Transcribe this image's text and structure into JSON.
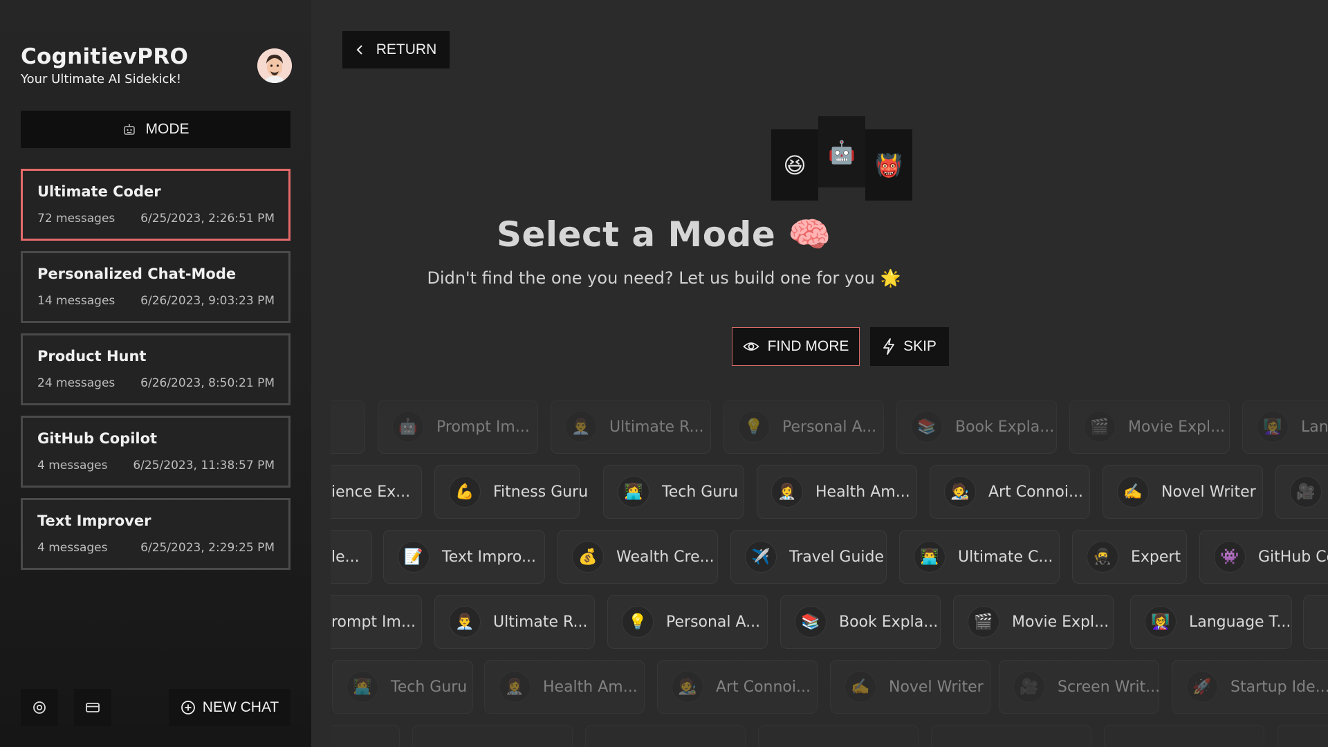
{
  "brand": {
    "title": "CognitievPRO",
    "subtitle": "Your Ultimate AI Sidekick!"
  },
  "sidebar": {
    "mode_label": "MODE",
    "chats": [
      {
        "title": "Ultimate Coder",
        "messages": "72 messages",
        "date": "6/25/2023, 2:26:51 PM",
        "active": true
      },
      {
        "title": "Personalized Chat-Mode",
        "messages": "14 messages",
        "date": "6/26/2023, 9:03:23 PM"
      },
      {
        "title": "Product Hunt",
        "messages": "24 messages",
        "date": "6/26/2023, 8:50:21 PM"
      },
      {
        "title": "GitHub Copilot",
        "messages": "4 messages",
        "date": "6/25/2023, 11:38:57 PM"
      },
      {
        "title": "Text Improver",
        "messages": "4 messages",
        "date": "6/25/2023, 2:29:25 PM"
      }
    ],
    "new_chat_label": "NEW CHAT"
  },
  "main": {
    "return_label": "RETURN",
    "cards": [
      "😆",
      "🤖",
      "👹"
    ],
    "headline": "Select a Mode",
    "headline_emoji": "🧠",
    "subline": "Didn't find the one you need? Let us build one for you",
    "subline_emoji": "🌟",
    "find_more_label": "FIND MORE",
    "skip_label": "SKIP"
  },
  "mode_rows": [
    {
      "items": [
        {
          "icon": "",
          "label": "..."
        },
        {
          "icon": "🤖",
          "label": "Prompt Im..."
        },
        {
          "icon": "👨‍💼",
          "label": "Ultimate R..."
        },
        {
          "icon": "💡",
          "label": "Personal A..."
        },
        {
          "icon": "📚",
          "label": "Book Expla..."
        },
        {
          "icon": "🎬",
          "label": "Movie Expl..."
        },
        {
          "icon": "👩‍🏫",
          "label": "Lan"
        }
      ]
    },
    {
      "items": [
        {
          "icon": "",
          "label": "ience Ex..."
        },
        {
          "icon": "💪",
          "label": "Fitness Guru"
        },
        {
          "icon": "👩‍💻",
          "label": "Tech Guru"
        },
        {
          "icon": "👩‍⚕️",
          "label": "Health Am..."
        },
        {
          "icon": "🧑‍🎨",
          "label": "Art Connoi..."
        },
        {
          "icon": "✍️",
          "label": "Novel Writer"
        },
        {
          "icon": "🎥",
          "label": ""
        }
      ]
    },
    {
      "items": [
        {
          "icon": "",
          "label": "le..."
        },
        {
          "icon": "📝",
          "label": "Text Impro..."
        },
        {
          "icon": "💰",
          "label": "Wealth Cre..."
        },
        {
          "icon": "✈️",
          "label": "Travel Guide"
        },
        {
          "icon": "👨‍💻",
          "label": "Ultimate C..."
        },
        {
          "icon": "🥷",
          "label": "Expert"
        },
        {
          "icon": "👾",
          "label": "GitHub Co"
        }
      ]
    },
    {
      "items": [
        {
          "icon": "",
          "label": "rompt Im..."
        },
        {
          "icon": "👨‍💼",
          "label": "Ultimate R..."
        },
        {
          "icon": "💡",
          "label": "Personal A..."
        },
        {
          "icon": "📚",
          "label": "Book Expla..."
        },
        {
          "icon": "🎬",
          "label": "Movie Expl..."
        },
        {
          "icon": "👩‍🏫",
          "label": "Language T..."
        },
        {
          "icon": "",
          "label": ""
        }
      ]
    },
    {
      "items": [
        {
          "icon": "👩‍💻",
          "label": "Tech Guru"
        },
        {
          "icon": "👩‍⚕️",
          "label": "Health Am..."
        },
        {
          "icon": "🧑‍🎨",
          "label": "Art Connoi..."
        },
        {
          "icon": "✍️",
          "label": "Novel Writer"
        },
        {
          "icon": "🎥",
          "label": "Screen Writ..."
        },
        {
          "icon": "🚀",
          "label": "Startup Ide..."
        }
      ]
    },
    {
      "items": [
        {
          "icon": "",
          "label": ""
        },
        {
          "icon": "",
          "label": ""
        },
        {
          "icon": "",
          "label": ""
        },
        {
          "icon": "",
          "label": ""
        },
        {
          "icon": "",
          "label": ""
        },
        {
          "icon": "",
          "label": ""
        },
        {
          "icon": "",
          "label": ""
        }
      ]
    }
  ],
  "colors": {
    "accent_border": "#e46a6a",
    "sidebar_bg": "#1f1f1f",
    "main_bg": "#2b2b2b",
    "button_bg": "#121212"
  }
}
